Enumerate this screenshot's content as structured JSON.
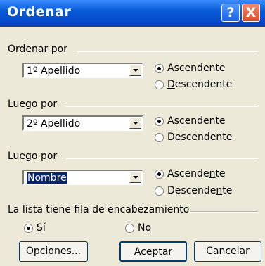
{
  "window": {
    "title": "Ordenar"
  },
  "titlebar_buttons": {
    "help": "?",
    "close": "X"
  },
  "sort1": {
    "label": "Ordenar por",
    "value": "1º Apellido",
    "asc": {
      "pre": "",
      "key": "A",
      "post": "scendente"
    },
    "desc": {
      "pre": "",
      "key": "D",
      "post": "escendente"
    },
    "selected": "asc"
  },
  "sort2": {
    "label": "Luego por",
    "value": "2º Apellido",
    "asc": {
      "pre": "As",
      "key": "c",
      "post": "endente"
    },
    "desc": {
      "pre": "D",
      "key": "e",
      "post": "scendente"
    },
    "selected": "asc"
  },
  "sort3": {
    "label": "Luego por",
    "value": "Nombre",
    "asc": {
      "pre": "Ascende",
      "key": "n",
      "post": "te"
    },
    "desc": {
      "pre": "Descende",
      "key": "n",
      "post": "te"
    },
    "selected": "asc"
  },
  "header_row": {
    "label": "La lista tiene fila de encabezamiento",
    "yes": {
      "pre": "",
      "key": "S",
      "post": "í"
    },
    "no": {
      "pre": "N",
      "key": "o",
      "post": ""
    },
    "selected": "yes"
  },
  "buttons": {
    "options": {
      "pre": "Op",
      "key": "c",
      "post": "iones..."
    },
    "accept": "Aceptar",
    "cancel": "Cancelar"
  }
}
